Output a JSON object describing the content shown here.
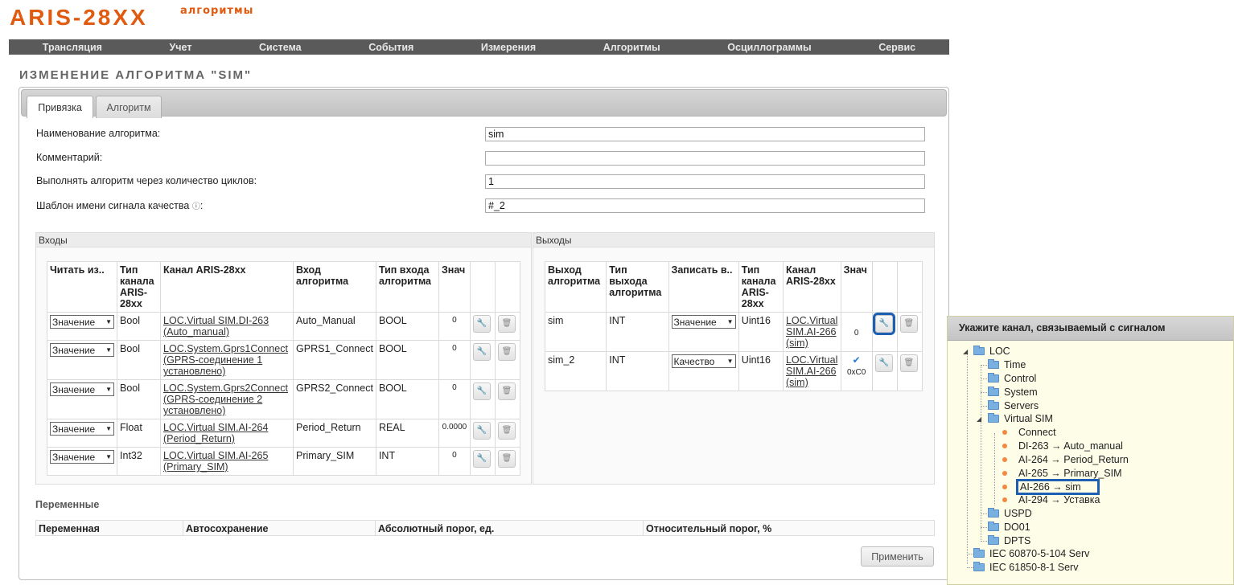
{
  "logo": {
    "main": "ARIS-28XX",
    "sub": "алгоритмы"
  },
  "nav": [
    "Трансляция",
    "Учет",
    "Система",
    "События",
    "Измерения",
    "Алгоритмы",
    "Осциллограммы",
    "Сервис"
  ],
  "page_title": "ИЗМЕНЕНИЕ АЛГОРИТМА \"SIM\"",
  "tabs": {
    "binding": "Привязка",
    "algorithm": "Алгоритм"
  },
  "fields": {
    "name_label": "Наименование алгоритма:",
    "name_value": "sim",
    "comment_label": "Комментарий:",
    "comment_value": "",
    "cycles_label": "Выполнять алгоритм через количество циклов:",
    "cycles_value": "1",
    "quality_label": "Шаблон имени сигнала качества",
    "quality_colon": ":",
    "quality_info": "ⓘ",
    "quality_value": "#_2"
  },
  "inputs": {
    "section_title": "Входы",
    "headers": [
      "Читать из..",
      "Тип канала ARIS-28xx",
      "Канал ARIS-28xx",
      "Вход алгоритма",
      "Тип входа алгоритма",
      "Знач"
    ],
    "rows": [
      {
        "read": "Значение",
        "type": "Bool",
        "channel": "LOC.Virtual SIM.DI-263 (Auto_manual)",
        "input": "Auto_Manual",
        "input_type": "BOOL",
        "value": "0"
      },
      {
        "read": "Значение",
        "type": "Bool",
        "channel": "LOC.System.Gprs1Connect (GPRS-соединение 1 установлено)",
        "input": "GPRS1_Connect",
        "input_type": "BOOL",
        "value": "0"
      },
      {
        "read": "Значение",
        "type": "Bool",
        "channel": "LOC.System.Gprs2Connect (GPRS-соединение 2 установлено)",
        "input": "GPRS2_Connect",
        "input_type": "BOOL",
        "value": "0"
      },
      {
        "read": "Значение",
        "type": "Float",
        "channel": "LOC.Virtual SIM.AI-264 (Period_Return)",
        "input": "Period_Return",
        "input_type": "REAL",
        "value": "0.0000"
      },
      {
        "read": "Значение",
        "type": "Int32",
        "channel": "LOC.Virtual SIM.AI-265 (Primary_SIM)",
        "input": "Primary_SIM",
        "input_type": "INT",
        "value": "0"
      }
    ]
  },
  "outputs": {
    "section_title": "Выходы",
    "headers": [
      "Выход алгоритма",
      "Тип выхода алгоритма",
      "Записать в..",
      "Тип канала ARIS-28xx",
      "Канал ARIS-28xx",
      "Знач"
    ],
    "rows": [
      {
        "output": "sim",
        "type": "INT",
        "write": "Значение",
        "channel_type": "Uint16",
        "channel": "LOC.Virtual SIM.AI-266 (sim)",
        "value": "0",
        "check": ""
      },
      {
        "output": "sim_2",
        "type": "INT",
        "write": "Качество",
        "channel_type": "Uint16",
        "channel": "LOC.Virtual SIM.AI-266 (sim)",
        "value": "0xC0",
        "check": "✔"
      }
    ]
  },
  "variables": {
    "title": "Переменные",
    "headers": [
      "Переменная",
      "Автосохранение",
      "Абсолютный порог, ед.",
      "Относительный порог, %"
    ]
  },
  "apply_label": "Применить",
  "tree": {
    "title": "Укажите канал, связываемый с сигналом",
    "nodes": {
      "loc": "LOC",
      "time": "Time",
      "control": "Control",
      "system": "System",
      "servers": "Servers",
      "virtual_sim": "Virtual SIM",
      "connect": "Connect",
      "di263": "DI-263 → Auto_manual",
      "ai264": "AI-264 → Period_Return",
      "ai265": "AI-265 → Primary_SIM",
      "ai266": "AI-266 → sim",
      "ai294": "AI-294 → Уставка",
      "uspd": "USPD",
      "do01": "DO01",
      "dpts": "DPTS",
      "iec104": "IEC 60870-5-104 Serv",
      "iec61850": "IEC 61850-8-1 Serv"
    }
  },
  "colors": {
    "brand": "#e05a10",
    "nav_bg": "#5a5a5a",
    "highlight": "#1d5fb3",
    "leaf": "#f08a40",
    "folder": "#7ab0e0"
  },
  "icons": {
    "edit": "wrench-icon",
    "delete": "trash-icon",
    "info": "info-icon"
  }
}
